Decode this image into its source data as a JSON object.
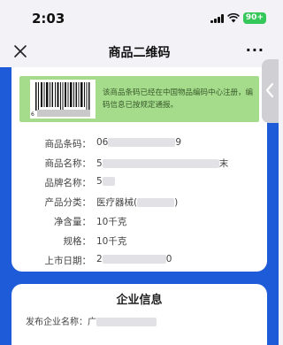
{
  "status_bar": {
    "time": "2:03",
    "battery": "90+",
    "battery_color": "#34c759"
  },
  "nav": {
    "title": "商品二维码",
    "close_icon": "close-icon",
    "more_label": "···"
  },
  "notice": {
    "barcode_digit": "6",
    "text": "该商品条码已经在中国物品编码中心注册，编码信息已按规定通报。",
    "background": "#a4dc8c"
  },
  "product": {
    "rows": [
      {
        "label": "商品条码：",
        "value_prefix": "06",
        "value_suffix": "9"
      },
      {
        "label": "商品名称：",
        "value_prefix": "5",
        "value_suffix": "末"
      },
      {
        "label": "品牌名称：",
        "value_prefix": "5",
        "value_suffix": ""
      },
      {
        "label": "产品分类：",
        "value_prefix": "医疗器械(",
        "value_suffix": ")"
      },
      {
        "label": "净含量：",
        "value_prefix": "10千克",
        "value_suffix": ""
      },
      {
        "label": "规格：",
        "value_prefix": "10千克",
        "value_suffix": ""
      },
      {
        "label": "上市日期：",
        "value_prefix": "2",
        "value_suffix": "0"
      }
    ]
  },
  "company": {
    "title": "企业信息",
    "publisher_label": "发布企业名称：",
    "publisher_prefix": "广"
  },
  "colors": {
    "brand_blue": "#1e5bd8",
    "page_bg": "#f2f2f7"
  }
}
